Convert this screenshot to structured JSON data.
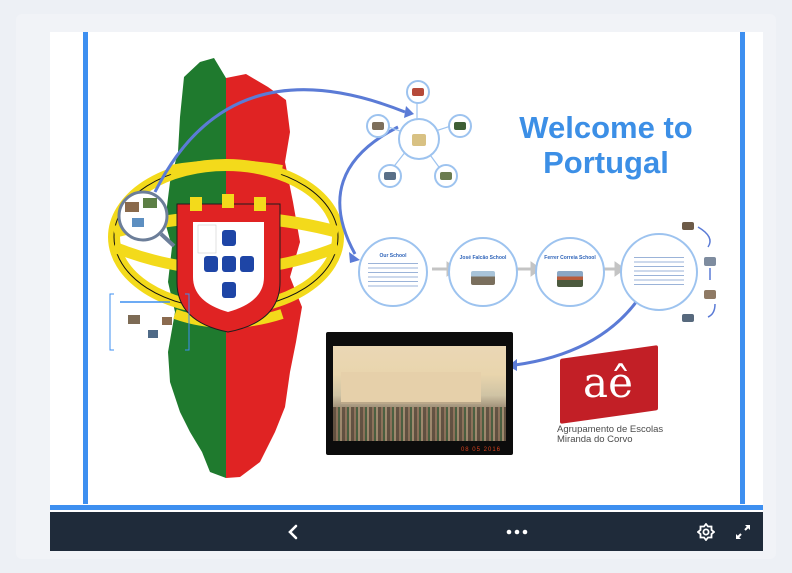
{
  "presentation": {
    "title_line1": "Welcome to",
    "title_line2": "Portugal",
    "logo": {
      "glyph": "aê",
      "line1": "Agrupamento de Escolas",
      "line2": "Miranda do Corvo",
      "brand_color": "#c21f26"
    },
    "photo": {
      "date_stamp": "08 05 2016"
    },
    "accent_color": "#3d8ff0",
    "title_color": "#3c8fe6",
    "path_nodes": [
      {
        "title": "Our School"
      },
      {
        "title": "José Falcão School"
      },
      {
        "title": "Ferrer Correia School"
      }
    ]
  },
  "toolbar": {
    "prev_icon": "chevron-left-icon",
    "more_icon": "more-dots-icon",
    "settings_icon": "gear-icon",
    "fullscreen_icon": "expand-icon",
    "background": "#1f2b3a"
  }
}
